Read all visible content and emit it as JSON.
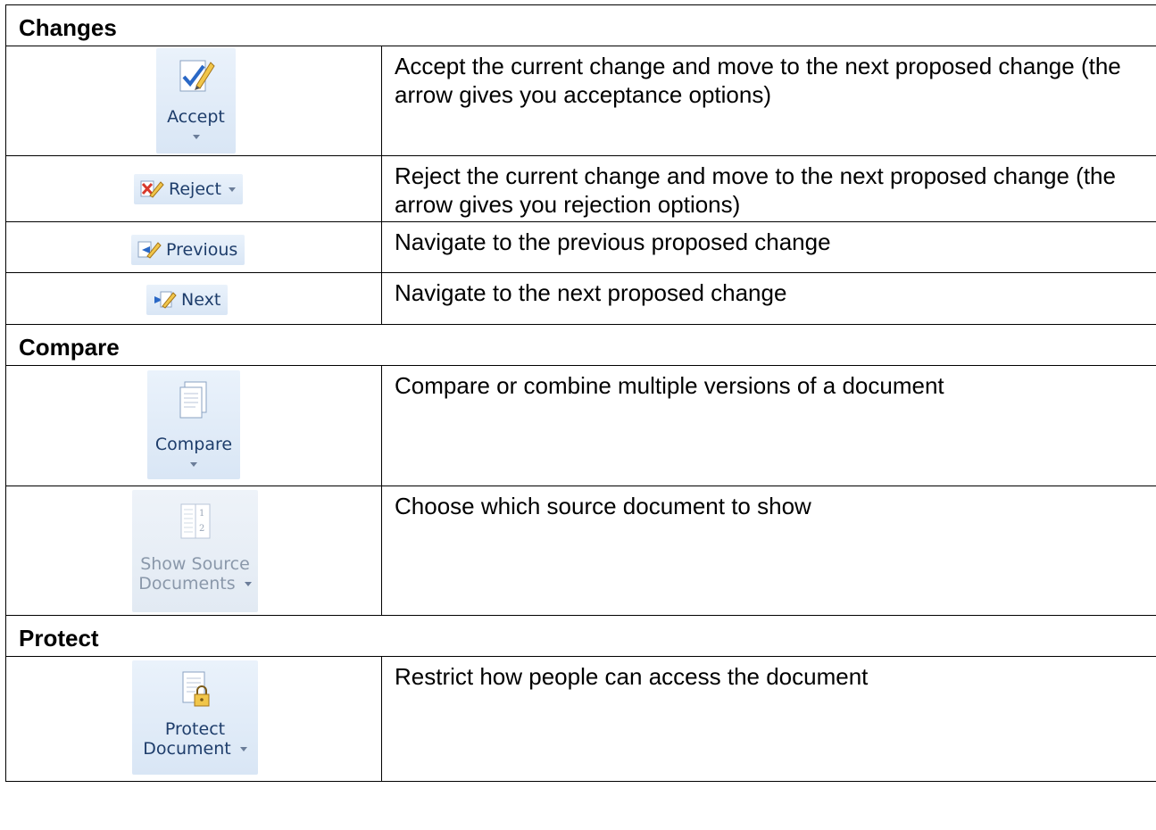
{
  "sections": {
    "changes": {
      "title": "Changes",
      "rows": {
        "accept": {
          "label": "Accept",
          "description": "Accept the current change and move to the next proposed change (the arrow gives you acceptance options)"
        },
        "reject": {
          "label": "Reject",
          "description": "Reject the current change and move to the next proposed change (the arrow gives you rejection options)"
        },
        "previous": {
          "label": "Previous",
          "description": "Navigate to the previous proposed change"
        },
        "next": {
          "label": "Next",
          "description": "Navigate to the next proposed change"
        }
      }
    },
    "compare": {
      "title": "Compare",
      "rows": {
        "compare": {
          "label": "Compare",
          "description": "Compare or combine multiple versions of a document"
        },
        "show_source": {
          "label_line1": "Show Source",
          "label_line2": "Documents",
          "description": "Choose which source document to show"
        }
      }
    },
    "protect": {
      "title": "Protect",
      "rows": {
        "protect": {
          "label_line1": "Protect",
          "label_line2": "Document",
          "description": "Restrict how people can access the document"
        }
      }
    }
  },
  "colors": {
    "button_bg": "#dde8f5",
    "button_text": "#1e3d6b",
    "disabled_text": "#8a98aa"
  },
  "icons": [
    "accept-changes-icon",
    "reject-changes-icon",
    "previous-change-icon",
    "next-change-icon",
    "compare-document-icon",
    "show-source-documents-icon",
    "protect-document-icon"
  ]
}
